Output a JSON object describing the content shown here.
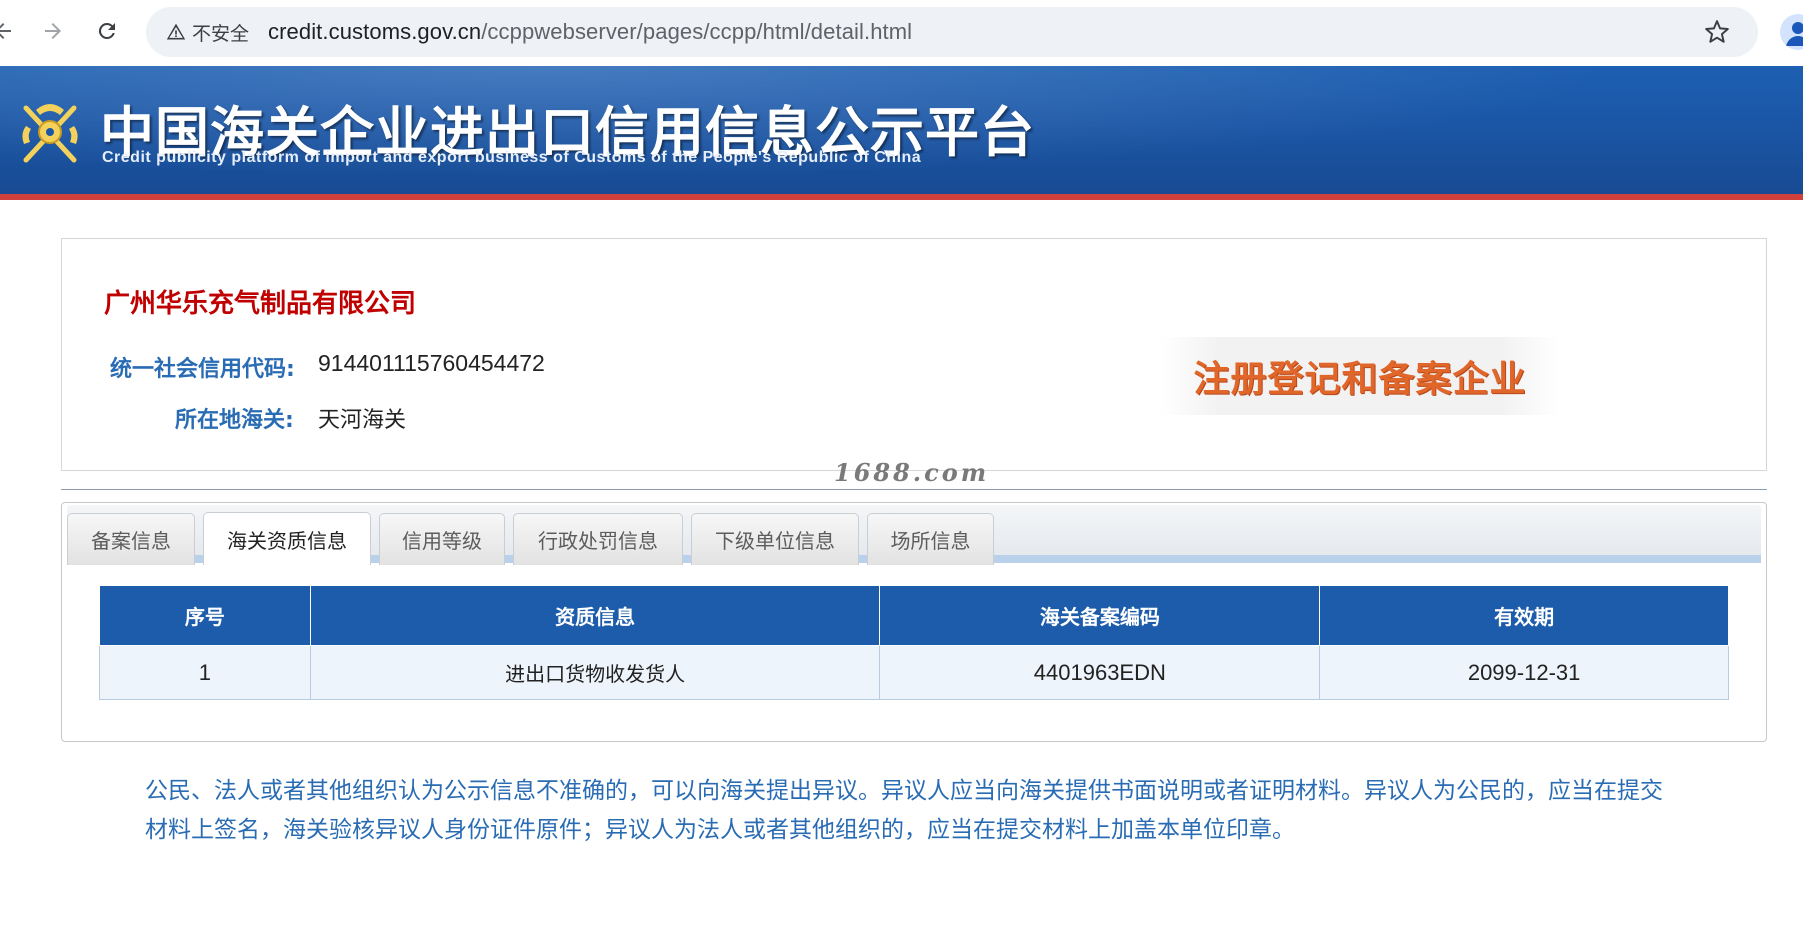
{
  "browser": {
    "security_label": "不安全",
    "url_host": "credit.customs.gov.cn",
    "url_path": "/ccppwebserver/pages/ccpp/html/detail.html",
    "icons": [
      "back-arrow-icon",
      "forward-arrow-icon",
      "reload-icon",
      "warning-triangle-icon",
      "star-icon",
      "profile-icon"
    ]
  },
  "header": {
    "title": "中国海关企业进出口信用信息公示平台",
    "subtitle": "Credit publicity platform of import and export business of Customs of the People's Republic of China",
    "colors": {
      "banner": "#1b56a6",
      "accent_line": "#d0403a"
    }
  },
  "company": {
    "name": "广州华乐充气制品有限公司",
    "credit_code_label": "统一社会信用代码:",
    "credit_code": "914401115760454472",
    "customs_label": "所在地海关:",
    "customs": "天河海关",
    "status": "注册登记和备案企业",
    "colors": {
      "name": "#c00000",
      "label": "#2a6cb4",
      "status": "#e0662a"
    }
  },
  "watermark": "1688.com",
  "tabs": [
    {
      "label": "备案信息",
      "active": false
    },
    {
      "label": "海关资质信息",
      "active": true
    },
    {
      "label": "信用等级",
      "active": false
    },
    {
      "label": "行政处罚信息",
      "active": false
    },
    {
      "label": "下级单位信息",
      "active": false
    },
    {
      "label": "场所信息",
      "active": false
    }
  ],
  "table": {
    "headers": [
      "序号",
      "资质信息",
      "海关备案编码",
      "有效期"
    ],
    "rows": [
      [
        "1",
        "进出口货物收发货人",
        "4401963EDN",
        "2099-12-31"
      ]
    ],
    "colors": {
      "header": "#1c5cab",
      "row": "#eef4fb"
    }
  },
  "notice": "公民、法人或者其他组织认为公示信息不准确的，可以向海关提出异议。异议人应当向海关提供书面说明或者证明材料。异议人为公民的，应当在提交材料上签名，海关验核异议人身份证件原件；异议人为法人或者其他组织的，应当在提交材料上加盖本单位印章。"
}
